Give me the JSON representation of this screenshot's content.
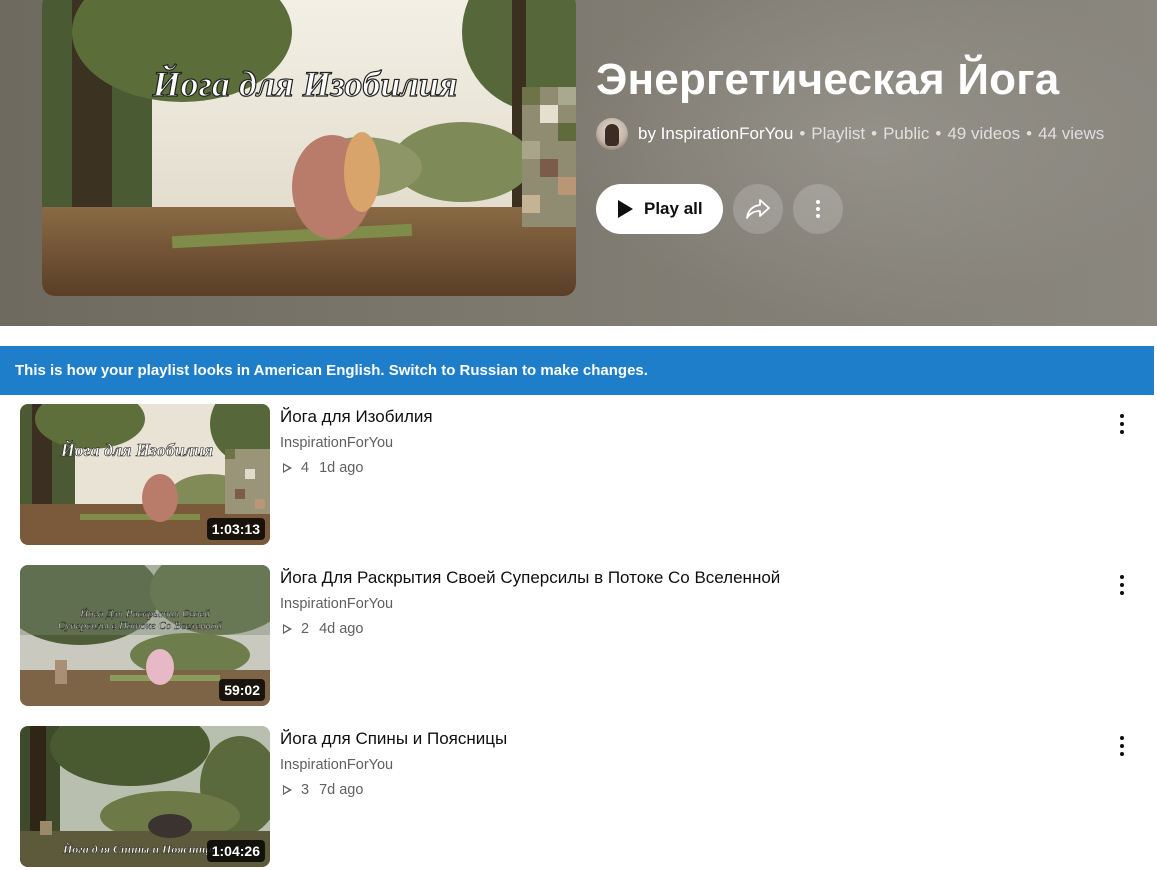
{
  "playlist": {
    "title": "Энергетическая Йога",
    "hero_overlay_text": "Йога для Изобилия",
    "owner": "by InspirationForYou",
    "type": "Playlist",
    "visibility": "Public",
    "video_count": "49 videos",
    "views": "44 views",
    "play_all_label": "Play all",
    "icons": {
      "play": "play-icon",
      "share": "share-icon",
      "more": "more-vert-icon"
    }
  },
  "banner": {
    "text": "This is how your playlist looks in American English. Switch to Russian to make changes.",
    "color": "#1f7ec9"
  },
  "videos": [
    {
      "title": "Йога для Изобилия",
      "channel": "InspirationForYou",
      "views": "4",
      "age": "1d ago",
      "duration": "1:03:13",
      "thumb_text": "Йога для Изобилия"
    },
    {
      "title": "Йога Для Раскрытия Своей Суперсилы в Потоке Со Вселенной",
      "channel": "InspirationForYou",
      "views": "2",
      "age": "4d ago",
      "duration": "59:02",
      "thumb_text_line1": "Йога Для Раскрытия Своей",
      "thumb_text_line2": "Суперсилы в Потоке Со Вселенной"
    },
    {
      "title": "Йога для Спины и Поясницы",
      "channel": "InspirationForYou",
      "views": "3",
      "age": "7d ago",
      "duration": "1:04:26",
      "thumb_text": "Йога для Спины и Поясницы"
    }
  ]
}
